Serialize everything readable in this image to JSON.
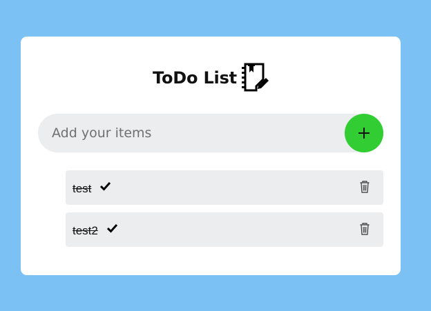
{
  "app": {
    "title": "ToDo List",
    "title_icon": "notebook-edit-icon"
  },
  "input": {
    "value": "",
    "placeholder": "Add your items",
    "add_button_icon": "plus-icon"
  },
  "items": [
    {
      "text": "test",
      "completed": true,
      "check_icon": "checkmark-icon",
      "delete_icon": "trash-icon"
    },
    {
      "text": "test2",
      "completed": true,
      "check_icon": "checkmark-icon",
      "delete_icon": "trash-icon"
    }
  ],
  "colors": {
    "background": "#7bc1f4",
    "card": "#ffffff",
    "input_bg": "#ecedef",
    "accent": "#32cd32",
    "item_bg": "#ecedef"
  }
}
